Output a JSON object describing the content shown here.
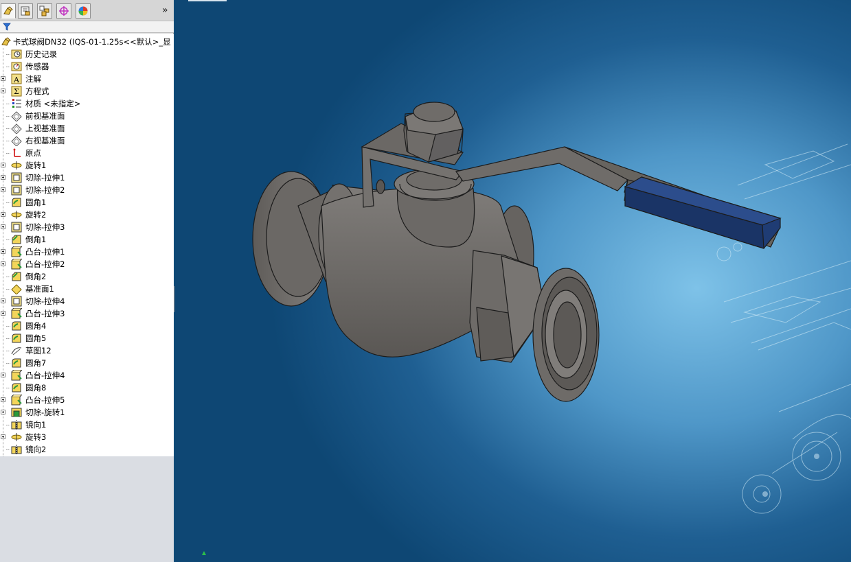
{
  "sidebar": {
    "tabs": [
      {
        "name": "featuremanager-tab",
        "icon": "feature-tree-icon"
      },
      {
        "name": "propertymanager-tab",
        "icon": "property-icon"
      },
      {
        "name": "configurationmanager-tab",
        "icon": "configuration-icon"
      },
      {
        "name": "dimxpert-tab",
        "icon": "dimxpert-icon"
      },
      {
        "name": "display-manager-tab",
        "icon": "appearance-icon"
      }
    ],
    "expand_glyph": "»",
    "root_label": "卡式球阀DN32  (IQS-01-1.25s<<默认>_显",
    "items": [
      {
        "label": "历史记录",
        "icon": "history-icon",
        "expandable": false
      },
      {
        "label": "传感器",
        "icon": "sensor-icon",
        "expandable": false
      },
      {
        "label": "注解",
        "icon": "annotation-icon",
        "expandable": true
      },
      {
        "label": "方程式",
        "icon": "equation-icon",
        "expandable": true
      },
      {
        "label": "材质 <未指定>",
        "icon": "material-icon",
        "expandable": false
      },
      {
        "label": "前视基准面",
        "icon": "plane-icon",
        "expandable": false
      },
      {
        "label": "上视基准面",
        "icon": "plane-icon",
        "expandable": false
      },
      {
        "label": "右视基准面",
        "icon": "plane-icon",
        "expandable": false
      },
      {
        "label": "原点",
        "icon": "origin-icon",
        "expandable": false
      },
      {
        "label": "旋转1",
        "icon": "revolve-icon",
        "expandable": true
      },
      {
        "label": "切除-拉伸1",
        "icon": "cut-extrude-icon",
        "expandable": true
      },
      {
        "label": "切除-拉伸2",
        "icon": "cut-extrude-icon",
        "expandable": true
      },
      {
        "label": "圆角1",
        "icon": "fillet-icon",
        "expandable": false
      },
      {
        "label": "旋转2",
        "icon": "revolve-icon",
        "expandable": true
      },
      {
        "label": "切除-拉伸3",
        "icon": "cut-extrude-icon",
        "expandable": true
      },
      {
        "label": "倒角1",
        "icon": "chamfer-icon",
        "expandable": false
      },
      {
        "label": "凸台-拉伸1",
        "icon": "boss-extrude-icon",
        "expandable": true
      },
      {
        "label": "凸台-拉伸2",
        "icon": "boss-extrude-icon",
        "expandable": true
      },
      {
        "label": "倒角2",
        "icon": "chamfer-icon",
        "expandable": false
      },
      {
        "label": "基准面1",
        "icon": "ref-plane-icon",
        "expandable": false
      },
      {
        "label": "切除-拉伸4",
        "icon": "cut-extrude-icon",
        "expandable": true
      },
      {
        "label": "凸台-拉伸3",
        "icon": "boss-extrude-icon",
        "expandable": true
      },
      {
        "label": "圆角4",
        "icon": "fillet-icon",
        "expandable": false
      },
      {
        "label": "圆角5",
        "icon": "fillet-icon",
        "expandable": false
      },
      {
        "label": "草图12",
        "icon": "sketch-icon",
        "expandable": false
      },
      {
        "label": "圆角7",
        "icon": "fillet-icon",
        "expandable": false
      },
      {
        "label": "凸台-拉伸4",
        "icon": "boss-extrude-icon",
        "expandable": true
      },
      {
        "label": "圆角8",
        "icon": "fillet-icon",
        "expandable": false
      },
      {
        "label": "凸台-拉伸5",
        "icon": "boss-extrude-icon",
        "expandable": true
      },
      {
        "label": "切除-旋转1",
        "icon": "cut-revolve-icon",
        "expandable": true
      },
      {
        "label": "镜向1",
        "icon": "mirror-icon",
        "expandable": false
      },
      {
        "label": "旋转3",
        "icon": "revolve-icon",
        "expandable": true
      },
      {
        "label": "镜向2",
        "icon": "mirror-icon",
        "expandable": false
      }
    ]
  },
  "viewport": {
    "model": "ball-valve-3d-model",
    "colors": {
      "background": "#1f5f92",
      "body": "#6d6a67",
      "handle_grip": "#1f3c74"
    }
  }
}
